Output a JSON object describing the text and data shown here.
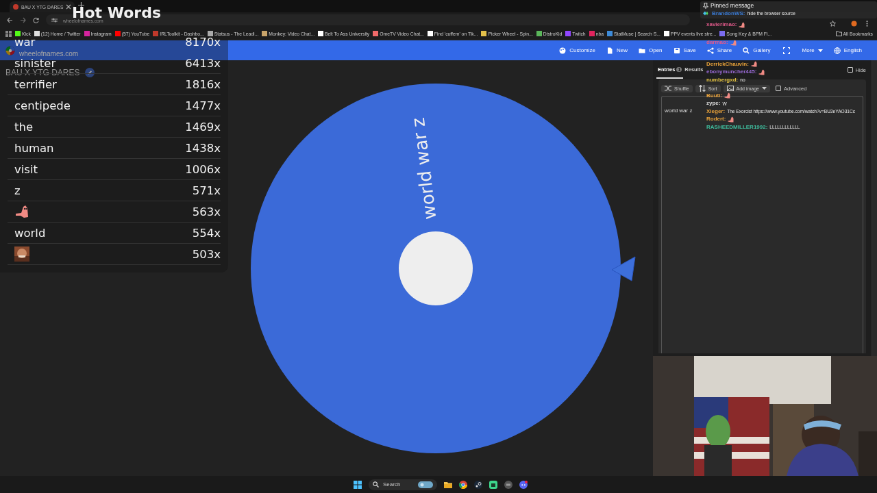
{
  "browser": {
    "tab": {
      "title": "BAU X YTG DARES"
    },
    "address": "wheelofnames.com",
    "bookmarks": [
      {
        "label": "Kick",
        "color": "#53fc18"
      },
      {
        "label": "(12) Home / Twitter",
        "color": "#dddddd"
      },
      {
        "label": "Instagram",
        "color": "#d6249f"
      },
      {
        "label": "(57) YouTube",
        "color": "#ff0000"
      },
      {
        "label": "IRLToolkit - Dashbo...",
        "color": "#c0392b"
      },
      {
        "label": "Statsus - The Leadi...",
        "color": "#aaaaaa"
      },
      {
        "label": "Monkey: Video Chat...",
        "color": "#c9a46a"
      },
      {
        "label": "Belt To Ass University",
        "color": "#ffffff"
      },
      {
        "label": "OmeTV Video Chat...",
        "color": "#f06a6a"
      },
      {
        "label": "Find 'cuffem' on Tik...",
        "color": "#ffffff"
      },
      {
        "label": "Picker Wheel - Spin...",
        "color": "#e3c04a"
      },
      {
        "label": "DistroKid",
        "color": "#5ab55a"
      },
      {
        "label": "Twitch",
        "color": "#9146ff"
      },
      {
        "label": "nba",
        "color": "#e0245e"
      },
      {
        "label": "StatMuse | Search S...",
        "color": "#3d8bd9"
      },
      {
        "label": "PPV events live stre...",
        "color": "#ffffff"
      },
      {
        "label": "Song Key & BPM Fi...",
        "color": "#7b6cf0"
      }
    ],
    "all_bookmarks": "All Bookmarks"
  },
  "site": {
    "brand": "wheelofnames.com",
    "menu": [
      "Customize",
      "New",
      "Open",
      "Save",
      "Share",
      "Gallery",
      "More",
      "English"
    ]
  },
  "wheel": {
    "title": "BAU X YTG DARES",
    "segments": [
      "world war z"
    ]
  },
  "panel": {
    "tabs": [
      {
        "label": "Entries",
        "count": "1",
        "selected": true
      },
      {
        "label": "Results",
        "selected": false
      }
    ],
    "hide": {
      "label": "Hide",
      "checked": false
    },
    "tools": [
      "Shuffle",
      "Sort",
      "Add image"
    ],
    "advanced": {
      "label": "Advanced",
      "checked": false
    },
    "entries": "world war z"
  },
  "hot_words": {
    "title": "Hot Words",
    "rows": [
      {
        "kind": "word",
        "word": "war",
        "count": "8170x"
      },
      {
        "kind": "word",
        "word": "sinister",
        "count": "6413x"
      },
      {
        "kind": "word",
        "word": "terrifier",
        "count": "1816x"
      },
      {
        "kind": "word",
        "word": "centipede",
        "count": "1477x"
      },
      {
        "kind": "word",
        "word": "the",
        "count": "1469x"
      },
      {
        "kind": "word",
        "word": "human",
        "count": "1438x"
      },
      {
        "kind": "word",
        "word": "visit",
        "count": "1006x"
      },
      {
        "kind": "word",
        "word": "z",
        "count": "571x"
      },
      {
        "kind": "emote",
        "count": "563x"
      },
      {
        "kind": "word",
        "word": "world",
        "count": "554x"
      },
      {
        "kind": "picture",
        "count": "503x"
      }
    ]
  },
  "chat": {
    "pinned": {
      "label": "Pinned message",
      "user": "BrandonWS:",
      "color": "#3a7bd5",
      "text": "hide the browser source"
    },
    "messages": [
      {
        "user": "xavierlmao:",
        "color": "#e05a8a",
        "emote": true
      },
      {
        "user": "darmao:",
        "color": "#e05a8a",
        "emote": true
      },
      {
        "user": "DerrickChauvin:",
        "color": "#e8a23a",
        "emote": true
      },
      {
        "user": "ebonymuncher445:",
        "color": "#9a6ad6",
        "emote": true
      },
      {
        "user": "numbergxd:",
        "color": "#e0c040",
        "text": "no",
        "emote": false
      },
      {
        "user": "Buuti:",
        "color": "#e8a23a",
        "emote": true
      },
      {
        "user": "zype:",
        "color": "#dddddd",
        "text": "W",
        "emote": false
      },
      {
        "user": "Xleger:",
        "color": "#e8a23a",
        "text": "The Exorcist https://www.youtube.com/watch?v=BU2eYAO31Cc",
        "emote": false
      },
      {
        "user": "Rodert:",
        "color": "#e8a23a",
        "emote": true
      },
      {
        "user": "RASHEEDMILLER1992:",
        "color": "#3fbf9f",
        "text": "LLLLLLLLLLLL",
        "emote": false
      }
    ]
  },
  "taskbar": {
    "search": "Search"
  }
}
